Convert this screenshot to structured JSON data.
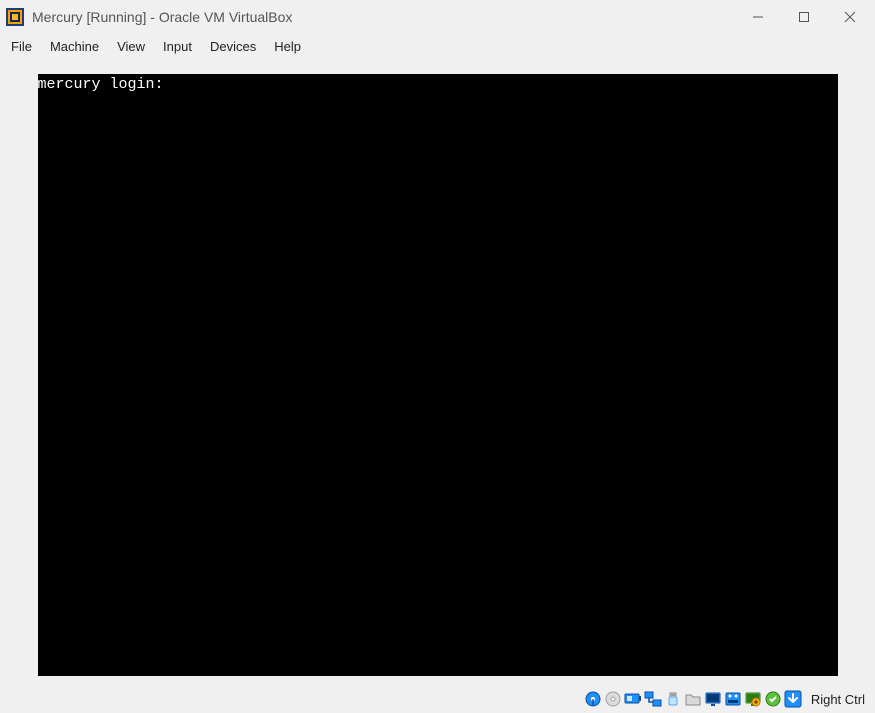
{
  "window": {
    "title": "Mercury [Running] - Oracle VM VirtualBox"
  },
  "menu": {
    "items": [
      "File",
      "Machine",
      "View",
      "Input",
      "Devices",
      "Help"
    ]
  },
  "vm": {
    "console_text": "mercury login:"
  },
  "status": {
    "icons": [
      "hard-disk",
      "optical-disc",
      "audio",
      "network",
      "usb",
      "shared-folder",
      "display",
      "video-capture",
      "guest-additions",
      "activity",
      "host-key-indicator"
    ],
    "host_key_label": "Right Ctrl"
  }
}
